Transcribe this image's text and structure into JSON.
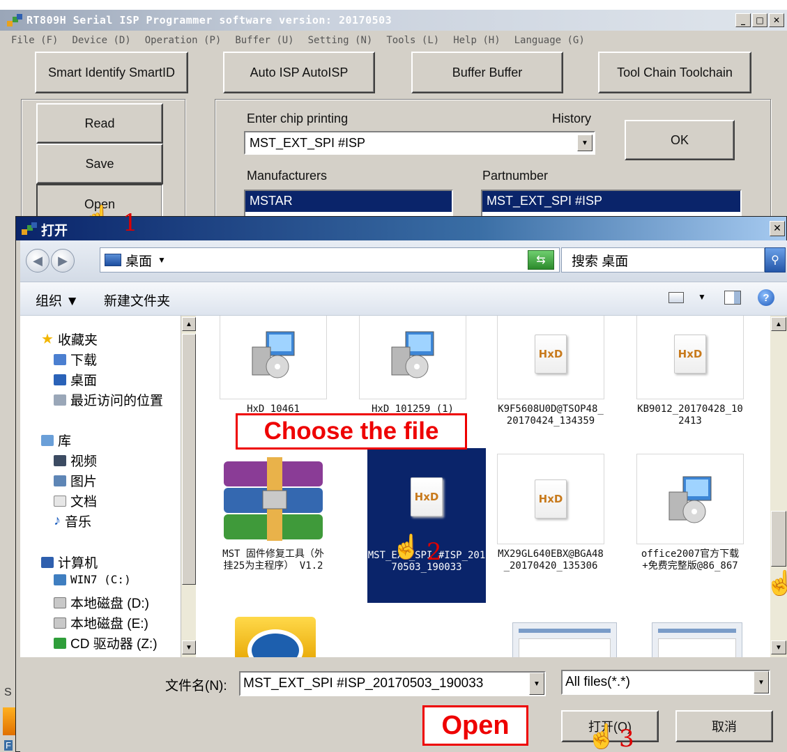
{
  "app": {
    "title": "RT809H Serial ISP Programmer software version: 20170503",
    "menu": [
      "File (F)",
      "Device (D)",
      "Operation (P)",
      "Buffer (U)",
      "Setting (N)",
      "Tools (L)",
      "Help (H)",
      "Language (G)"
    ],
    "tabs": [
      "Smart Identify SmartID",
      "Auto ISP AutoISP",
      "Buffer Buffer",
      "Tool Chain Toolchain"
    ],
    "side_buttons": [
      "Read",
      "Save",
      "Open"
    ],
    "chip_label": "Enter chip printing",
    "history_label": "History",
    "chip_value": "MST_EXT_SPI #ISP",
    "ok_label": "OK",
    "manufacturers_label": "Manufacturers",
    "partnumber_label": "Partnumber",
    "manufacturer_selected": "MSTAR",
    "partnumber_selected": "MST_EXT_SPI #ISP",
    "left_edge_letters": [
      "S",
      "F"
    ]
  },
  "dialog": {
    "title": "打开",
    "location": "桌面",
    "search_placeholder": "搜索 桌面",
    "organize": "组织 ▼",
    "new_folder": "新建文件夹",
    "nav": {
      "favorites": "收藏夹",
      "downloads": "下载",
      "desktop": "桌面",
      "recent": "最近访问的位置",
      "libraries": "库",
      "videos": "视频",
      "pictures": "图片",
      "documents": "文档",
      "music": "音乐",
      "computer": "计算机",
      "drive_c": "WIN7 (C:)",
      "drive_d": "本地磁盘 (D:)",
      "drive_e": "本地磁盘 (E:)",
      "drive_z": "CD 驱动器 (Z:)"
    },
    "files": [
      {
        "name": "HxD_10461",
        "icon": "installer-icon"
      },
      {
        "name": "HxD_101259 (1)",
        "icon": "installer-icon"
      },
      {
        "name": "K9F5608U0D@TSOP48_20170424_134359",
        "icon": "hxd-file-icon"
      },
      {
        "name": "KB9012_20170428_102413",
        "icon": "hxd-file-icon"
      },
      {
        "name": "MST 固件修复工具（外挂25为主程序） V1.2",
        "icon": "winrar-icon"
      },
      {
        "name": "MST_EXT_SPI #ISP_20170503_190033",
        "icon": "hxd-file-icon",
        "selected": true
      },
      {
        "name": "MX29GL640EBX@BGA48_20170420_135306",
        "icon": "hxd-file-icon"
      },
      {
        "name": "office2007官方下载+免费完整版@86_867",
        "icon": "installer-icon"
      }
    ],
    "filename_label": "文件名(N):",
    "filename_value": "MST_EXT_SPI #ISP_20170503_190033",
    "filetype_value": "All files(*.*)",
    "open_button": "打开(O)",
    "cancel_button": "取消"
  },
  "annotations": {
    "choose_text": "Choose the file",
    "open_text": "Open",
    "step1": "1",
    "step2": "2",
    "step3": "3"
  },
  "colors": {
    "selection": "#0a246a",
    "annotation_red": "#e00000",
    "window_gray": "#d4d0c8"
  }
}
